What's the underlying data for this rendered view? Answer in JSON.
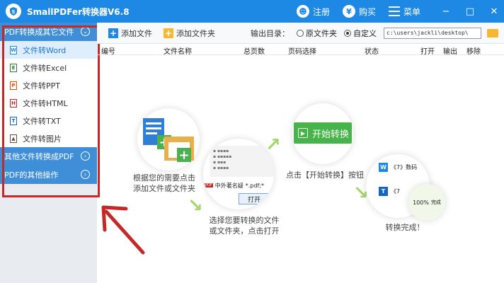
{
  "app": {
    "title": "SmallPDFer转换器V6.8",
    "register_label": "注册",
    "buy_label": "购买",
    "menu_label": "菜单",
    "minimize": "−",
    "maximize": "□",
    "close": "✕"
  },
  "sidebar": {
    "group_main": "PDF转换成其它文件",
    "items": [
      {
        "label": "文件转Word",
        "icon_letter": "W",
        "icon_color": "#1e88e5"
      },
      {
        "label": "文件转Excel",
        "icon_letter": "E",
        "icon_color": "#2e7d32"
      },
      {
        "label": "文件转PPT",
        "icon_letter": "P",
        "icon_color": "#e65100"
      },
      {
        "label": "文件转HTML",
        "icon_letter": "H",
        "icon_color": "#c62828"
      },
      {
        "label": "文件转TXT",
        "icon_letter": "T",
        "icon_color": "#1565c0"
      },
      {
        "label": "文件转图片",
        "icon_letter": "▲",
        "icon_color": "#6d4c41"
      }
    ],
    "group_other": "其他文件转换成PDF",
    "group_ops": "PDF的其他操作"
  },
  "toolbar": {
    "add_file": "添加文件",
    "add_folder": "添加文件夹",
    "output_label": "输出目录：",
    "option_original": "原文件夹",
    "option_custom": "自定义",
    "output_path": "c:\\users\\jackli\\desktop\\"
  },
  "table": {
    "columns": [
      "编号",
      "文件名称",
      "总页数",
      "页码选择",
      "状态",
      "打开",
      "输出",
      "移除"
    ]
  },
  "guide": {
    "step1_line1": "根据您的需要点击",
    "step1_line2": "添加文件或文件夹",
    "step2_line1": "选择您要转换的文件",
    "step2_line2": "或文件夹，点击打开",
    "step2_filename": "中外著名疑",
    "step2_filter": "*.pdf;*",
    "step2_open": "打开",
    "start_button": "开始转换",
    "step3": "点击【开始转换】按钮",
    "step4": "转换完成！",
    "done_item1": "《7》数码",
    "done_item2": "《7",
    "done_progress": "100%",
    "done_status": "完成"
  },
  "colors": {
    "titlebar": "#1e88e5",
    "sidebar_header": "#3f8fd8",
    "highlight_frame": "#c62828",
    "start_button": "#45b549"
  }
}
